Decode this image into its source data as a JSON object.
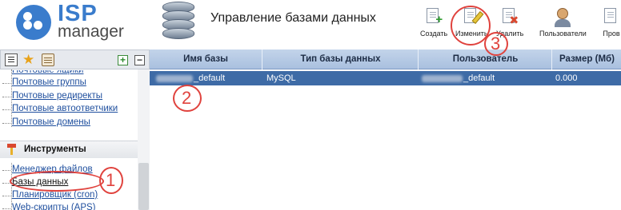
{
  "brand": {
    "name_top": "ISP",
    "name_bottom": "manager"
  },
  "header": {
    "title": "Управление базами данных"
  },
  "toolbar": {
    "create": "Создать",
    "edit": "Изменить",
    "delete": "Удалить",
    "users": "Пользователи",
    "more": "Пров"
  },
  "sidebar": {
    "mail_items": [
      "Почтовые ящики",
      "Почтовые группы",
      "Почтовые редиректы",
      "Почтовые автоответчики",
      "Почтовые домены"
    ],
    "tools_group": "Инструменты",
    "tools_items": [
      "Менеджер файлов",
      "Базы данных",
      "Планировщик (cron)",
      "Web-скрипты (APS)"
    ]
  },
  "table": {
    "columns": [
      "Имя базы",
      "Тип базы данных",
      "Пользователь",
      "Размер (Мб)"
    ],
    "rows": [
      {
        "name": "_default",
        "type": "MySQL",
        "user": "_default",
        "size": "0.000"
      }
    ]
  },
  "callouts": [
    "1",
    "2",
    "3"
  ],
  "colors": {
    "accent": "#3a7ccc",
    "selected_row": "#3e6ba6",
    "callout": "#e0433e",
    "link": "#1f4f9e"
  }
}
